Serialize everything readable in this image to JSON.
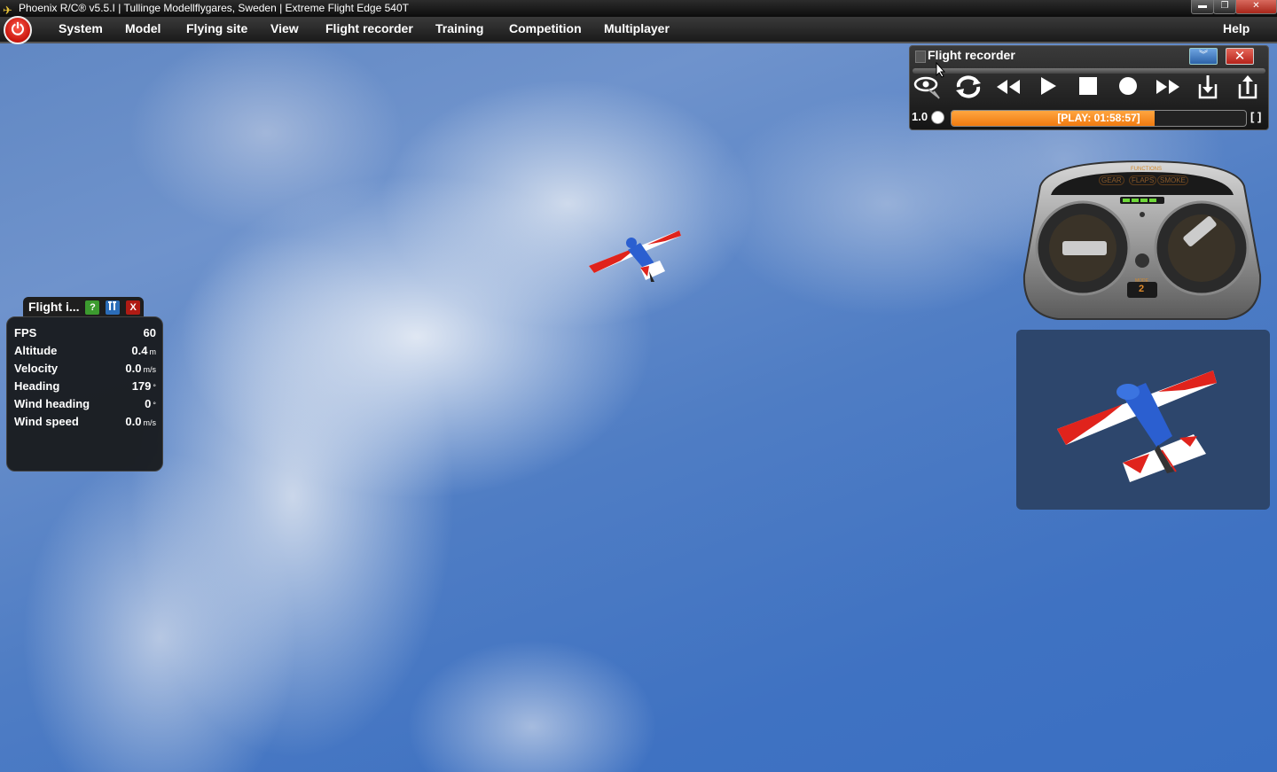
{
  "window": {
    "title": "Phoenix R/C® v5.5.I  |  Tullinge Modellflygares, Sweden  |  Extreme Flight Edge 540T",
    "min_glyph": "▬",
    "max_glyph": "❐",
    "close_glyph": "✕"
  },
  "menu": {
    "items": [
      "System",
      "Model",
      "Flying site",
      "View",
      "Flight recorder",
      "Training",
      "Competition",
      "Multiplayer"
    ],
    "help": "Help"
  },
  "flight_info": {
    "title": "Flight i...",
    "help_glyph": "?",
    "close_glyph": "X",
    "rows": [
      {
        "label": "FPS",
        "value": "60",
        "unit": ""
      },
      {
        "label": "Altitude",
        "value": "0.4",
        "unit": "m"
      },
      {
        "label": "Velocity",
        "value": "0.0",
        "unit": "m/s"
      },
      {
        "label": "Heading",
        "value": "179",
        "unit": "°"
      },
      {
        "label": "Wind heading",
        "value": "0",
        "unit": "°"
      },
      {
        "label": "Wind speed",
        "value": "0.0",
        "unit": "m/s"
      }
    ]
  },
  "flight_recorder": {
    "title": "Flight recorder",
    "collapse_glyph": "︾",
    "close_glyph": "✕",
    "speed": "1.0",
    "status": "[PLAY: 01:58:57]",
    "progress": 0.69,
    "bracket": "[ ]",
    "accent": "#f59a2e"
  },
  "transmitter": {
    "functions_label": "FUNCTIONS",
    "buttons": [
      "GEAR",
      "FLAPS",
      "SMOKE"
    ],
    "mode_label": "MODE",
    "mode_value": "2"
  },
  "colors": {
    "plane_red": "#e0231c",
    "plane_blue": "#2b5fd0",
    "panel_bg": "#1c1e20"
  }
}
